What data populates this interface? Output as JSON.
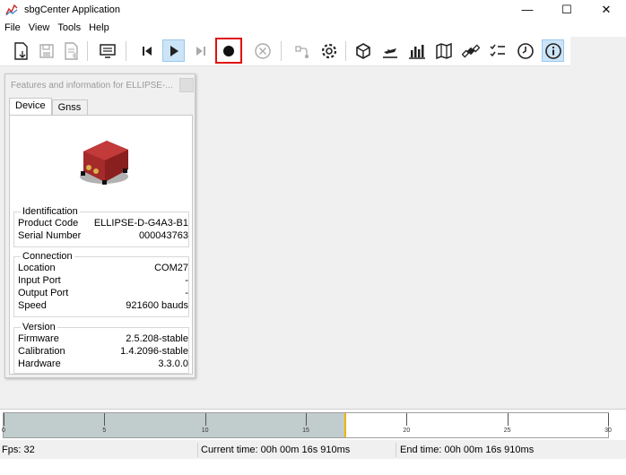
{
  "window": {
    "title": "sbgCenter Application",
    "minimize": "—",
    "maximize": "☐",
    "close": "✕"
  },
  "menu": [
    "File",
    "View",
    "Tools",
    "Help"
  ],
  "toolbar": {
    "accent_active": "#cce4f7",
    "record_highlight": "#e01010",
    "buttons": [
      "new-session-icon",
      "save-icon",
      "export-icon",
      "console-icon",
      "skip-back-icon",
      "play-icon",
      "skip-forward-icon",
      "record-icon",
      "stop-icon",
      "connect-icon",
      "settings-icon",
      "3d-view-icon",
      "airplane-icon",
      "bar-chart-icon",
      "map-icon",
      "satellite-icon",
      "checklist-icon",
      "clock-icon",
      "info-icon"
    ]
  },
  "panel": {
    "title": "Features and information for ELLIPSE-...",
    "tabs": [
      "Device",
      "Gnss"
    ],
    "identification": {
      "title": "Identification",
      "rows": [
        {
          "key": "Product Code",
          "value": "ELLIPSE-D-G4A3-B1"
        },
        {
          "key": "Serial Number",
          "value": "000043763"
        }
      ]
    },
    "connection": {
      "title": "Connection",
      "rows": [
        {
          "key": "Location",
          "value": "COM27"
        },
        {
          "key": "Input Port",
          "value": "-"
        },
        {
          "key": "Output Port",
          "value": "-"
        },
        {
          "key": "Speed",
          "value": "921600 bauds"
        }
      ]
    },
    "version": {
      "title": "Version",
      "rows": [
        {
          "key": "Firmware",
          "value": "2.5.208-stable"
        },
        {
          "key": "Calibration",
          "value": "1.4.2096-stable"
        },
        {
          "key": "Hardware",
          "value": "3.3.0.0"
        }
      ]
    }
  },
  "timeline": {
    "ticks": [
      "0",
      "5",
      "10",
      "15",
      "20",
      "25",
      "30"
    ],
    "recorded_seconds": 16.91,
    "fill_color": "#c1cccc",
    "cursor_color": "#f0b400"
  },
  "status": {
    "fps": "Fps: 32",
    "current_time": "Current time: 00h 00m 16s 910ms",
    "end_time": "End time: 00h 00m 16s 910ms"
  }
}
